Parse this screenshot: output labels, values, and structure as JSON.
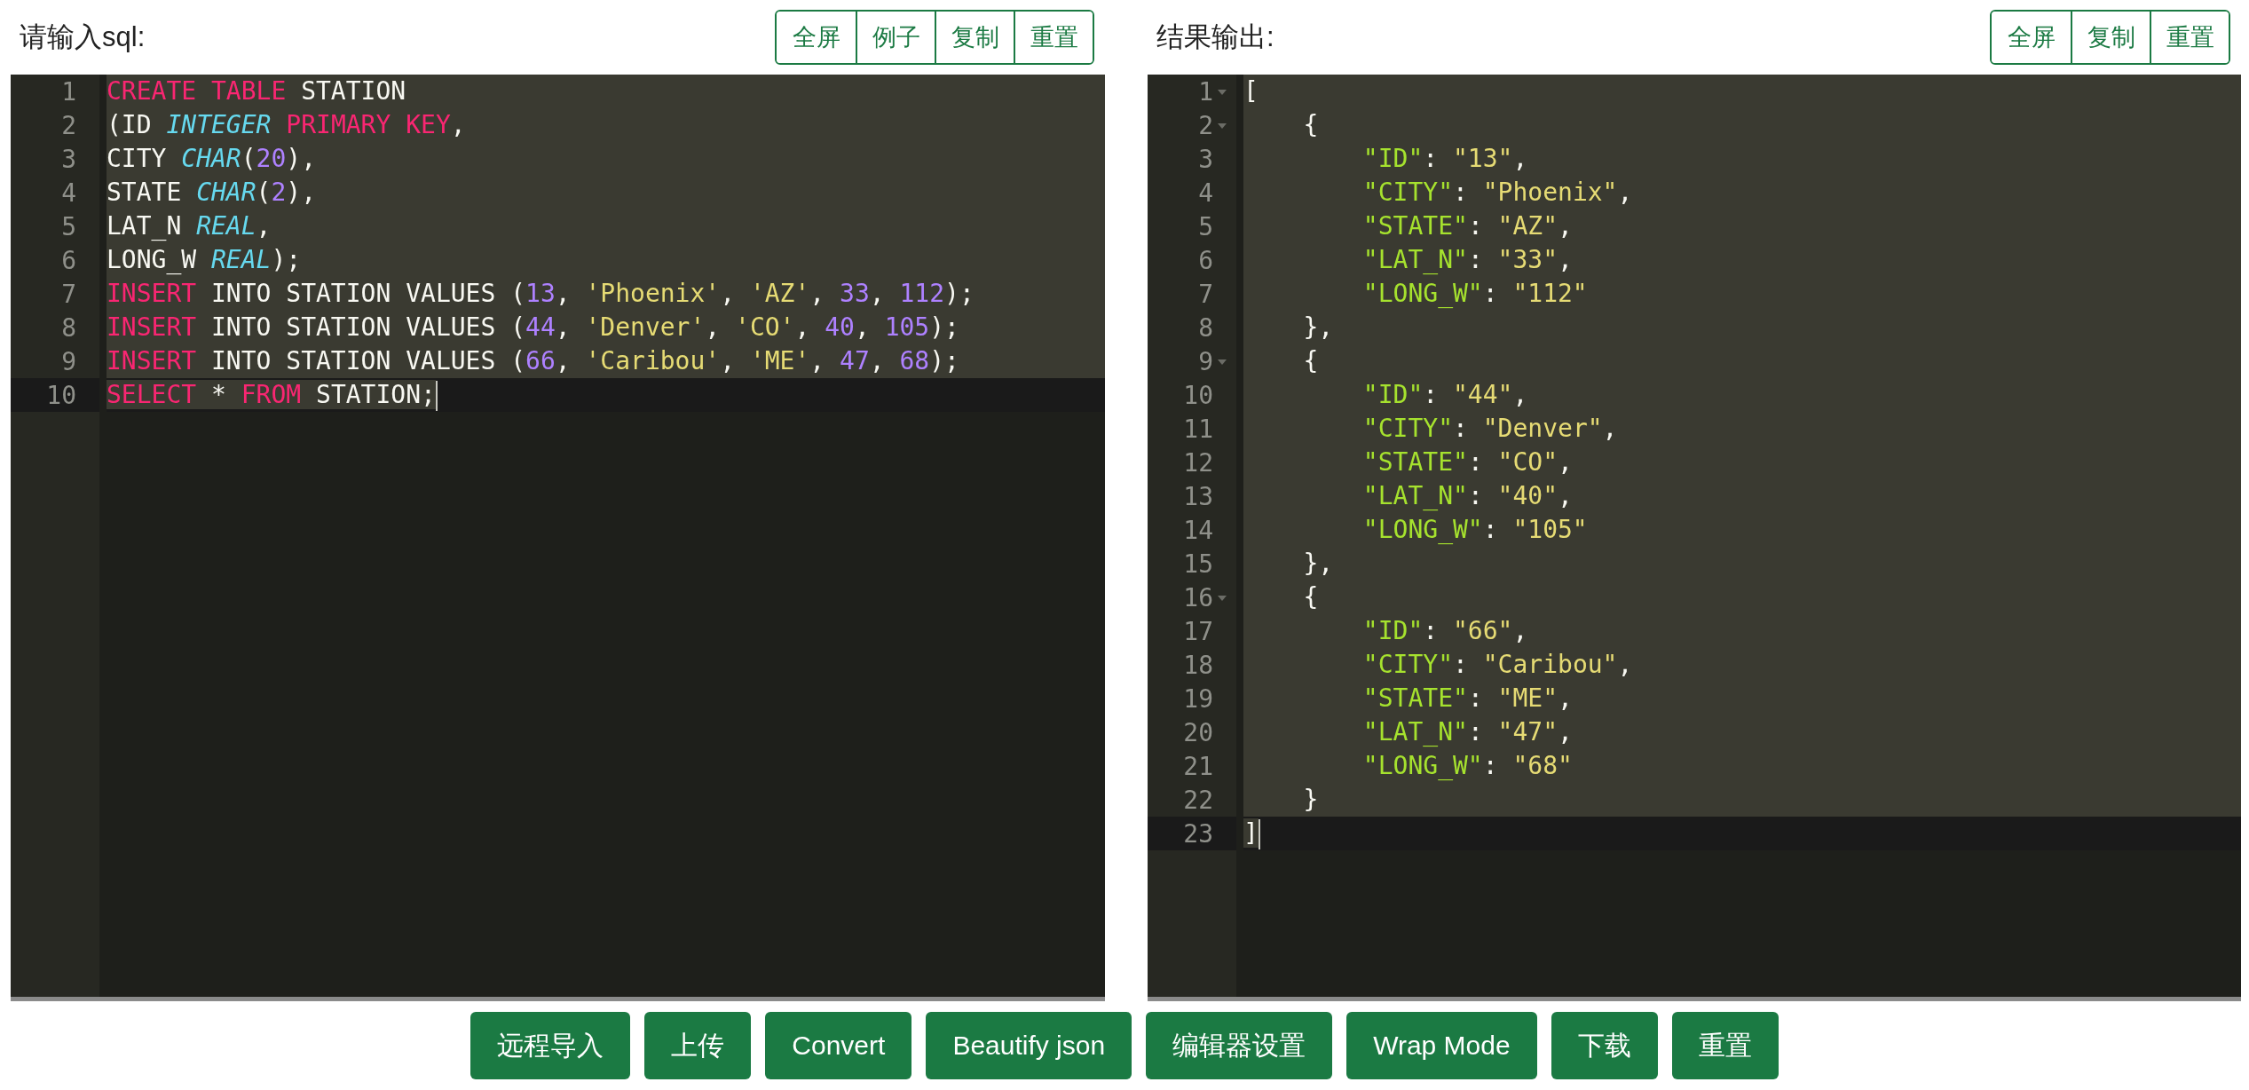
{
  "input_panel": {
    "title": "请输入sql:",
    "buttons": [
      "全屏",
      "例子",
      "复制",
      "重置"
    ],
    "editor": {
      "lines": [
        {
          "number": "1",
          "active": false,
          "tokens": [
            {
              "kind": "keyword",
              "text": "CREATE TABLE"
            },
            {
              "kind": "plain",
              "text": " STATION"
            }
          ]
        },
        {
          "number": "2",
          "active": false,
          "tokens": [
            {
              "kind": "plain",
              "text": "(ID "
            },
            {
              "kind": "type",
              "text": "INTEGER"
            },
            {
              "kind": "keyword",
              "text": " PRIMARY KEY"
            },
            {
              "kind": "plain",
              "text": ","
            }
          ]
        },
        {
          "number": "3",
          "active": false,
          "tokens": [
            {
              "kind": "plain",
              "text": "CITY "
            },
            {
              "kind": "type",
              "text": "CHAR"
            },
            {
              "kind": "plain",
              "text": "("
            },
            {
              "kind": "number",
              "text": "20"
            },
            {
              "kind": "plain",
              "text": "),"
            }
          ]
        },
        {
          "number": "4",
          "active": false,
          "tokens": [
            {
              "kind": "plain",
              "text": "STATE "
            },
            {
              "kind": "type",
              "text": "CHAR"
            },
            {
              "kind": "plain",
              "text": "("
            },
            {
              "kind": "number",
              "text": "2"
            },
            {
              "kind": "plain",
              "text": "),"
            }
          ]
        },
        {
          "number": "5",
          "active": false,
          "tokens": [
            {
              "kind": "plain",
              "text": "LAT_N "
            },
            {
              "kind": "type",
              "text": "REAL"
            },
            {
              "kind": "plain",
              "text": ","
            }
          ]
        },
        {
          "number": "6",
          "active": false,
          "tokens": [
            {
              "kind": "plain",
              "text": "LONG_W "
            },
            {
              "kind": "type",
              "text": "REAL"
            },
            {
              "kind": "plain",
              "text": ");"
            }
          ]
        },
        {
          "number": "7",
          "active": false,
          "tokens": [
            {
              "kind": "keyword",
              "text": "INSERT"
            },
            {
              "kind": "plain",
              "text": " INTO STATION VALUES ("
            },
            {
              "kind": "number",
              "text": "13"
            },
            {
              "kind": "plain",
              "text": ", "
            },
            {
              "kind": "string",
              "text": "'Phoenix'"
            },
            {
              "kind": "plain",
              "text": ", "
            },
            {
              "kind": "string",
              "text": "'AZ'"
            },
            {
              "kind": "plain",
              "text": ", "
            },
            {
              "kind": "number",
              "text": "33"
            },
            {
              "kind": "plain",
              "text": ", "
            },
            {
              "kind": "number",
              "text": "112"
            },
            {
              "kind": "plain",
              "text": ");"
            }
          ]
        },
        {
          "number": "8",
          "active": false,
          "tokens": [
            {
              "kind": "keyword",
              "text": "INSERT"
            },
            {
              "kind": "plain",
              "text": " INTO STATION VALUES ("
            },
            {
              "kind": "number",
              "text": "44"
            },
            {
              "kind": "plain",
              "text": ", "
            },
            {
              "kind": "string",
              "text": "'Denver'"
            },
            {
              "kind": "plain",
              "text": ", "
            },
            {
              "kind": "string",
              "text": "'CO'"
            },
            {
              "kind": "plain",
              "text": ", "
            },
            {
              "kind": "number",
              "text": "40"
            },
            {
              "kind": "plain",
              "text": ", "
            },
            {
              "kind": "number",
              "text": "105"
            },
            {
              "kind": "plain",
              "text": ");"
            }
          ]
        },
        {
          "number": "9",
          "active": false,
          "tokens": [
            {
              "kind": "keyword",
              "text": "INSERT"
            },
            {
              "kind": "plain",
              "text": " INTO STATION VALUES ("
            },
            {
              "kind": "number",
              "text": "66"
            },
            {
              "kind": "plain",
              "text": ", "
            },
            {
              "kind": "string",
              "text": "'Caribou'"
            },
            {
              "kind": "plain",
              "text": ", "
            },
            {
              "kind": "string",
              "text": "'ME'"
            },
            {
              "kind": "plain",
              "text": ", "
            },
            {
              "kind": "number",
              "text": "47"
            },
            {
              "kind": "plain",
              "text": ", "
            },
            {
              "kind": "number",
              "text": "68"
            },
            {
              "kind": "plain",
              "text": ");"
            }
          ]
        },
        {
          "number": "10",
          "active": true,
          "tokens": [
            {
              "kind": "keyword",
              "text": "SELECT"
            },
            {
              "kind": "plain",
              "text": " * "
            },
            {
              "kind": "keyword",
              "text": "FROM"
            },
            {
              "kind": "plain",
              "text": " STATION;"
            }
          ]
        }
      ]
    }
  },
  "output_panel": {
    "title": "结果输出:",
    "buttons": [
      "全屏",
      "复制",
      "重置"
    ],
    "editor": {
      "lines": [
        {
          "number": "1",
          "active": false,
          "foldable": true,
          "tokens": [
            {
              "kind": "plain",
              "text": "["
            }
          ]
        },
        {
          "number": "2",
          "active": false,
          "foldable": true,
          "tokens": [
            {
              "kind": "plain",
              "text": "    {"
            }
          ]
        },
        {
          "number": "3",
          "active": false,
          "foldable": false,
          "tokens": [
            {
              "kind": "key",
              "text": "        \"ID\""
            },
            {
              "kind": "plain",
              "text": ": "
            },
            {
              "kind": "string",
              "text": "\"13\""
            },
            {
              "kind": "plain",
              "text": ","
            }
          ]
        },
        {
          "number": "4",
          "active": false,
          "foldable": false,
          "tokens": [
            {
              "kind": "key",
              "text": "        \"CITY\""
            },
            {
              "kind": "plain",
              "text": ": "
            },
            {
              "kind": "string",
              "text": "\"Phoenix\""
            },
            {
              "kind": "plain",
              "text": ","
            }
          ]
        },
        {
          "number": "5",
          "active": false,
          "foldable": false,
          "tokens": [
            {
              "kind": "key",
              "text": "        \"STATE\""
            },
            {
              "kind": "plain",
              "text": ": "
            },
            {
              "kind": "string",
              "text": "\"AZ\""
            },
            {
              "kind": "plain",
              "text": ","
            }
          ]
        },
        {
          "number": "6",
          "active": false,
          "foldable": false,
          "tokens": [
            {
              "kind": "key",
              "text": "        \"LAT_N\""
            },
            {
              "kind": "plain",
              "text": ": "
            },
            {
              "kind": "string",
              "text": "\"33\""
            },
            {
              "kind": "plain",
              "text": ","
            }
          ]
        },
        {
          "number": "7",
          "active": false,
          "foldable": false,
          "tokens": [
            {
              "kind": "key",
              "text": "        \"LONG_W\""
            },
            {
              "kind": "plain",
              "text": ": "
            },
            {
              "kind": "string",
              "text": "\"112\""
            }
          ]
        },
        {
          "number": "8",
          "active": false,
          "foldable": false,
          "tokens": [
            {
              "kind": "plain",
              "text": "    },"
            }
          ]
        },
        {
          "number": "9",
          "active": false,
          "foldable": true,
          "tokens": [
            {
              "kind": "plain",
              "text": "    {"
            }
          ]
        },
        {
          "number": "10",
          "active": false,
          "foldable": false,
          "tokens": [
            {
              "kind": "key",
              "text": "        \"ID\""
            },
            {
              "kind": "plain",
              "text": ": "
            },
            {
              "kind": "string",
              "text": "\"44\""
            },
            {
              "kind": "plain",
              "text": ","
            }
          ]
        },
        {
          "number": "11",
          "active": false,
          "foldable": false,
          "tokens": [
            {
              "kind": "key",
              "text": "        \"CITY\""
            },
            {
              "kind": "plain",
              "text": ": "
            },
            {
              "kind": "string",
              "text": "\"Denver\""
            },
            {
              "kind": "plain",
              "text": ","
            }
          ]
        },
        {
          "number": "12",
          "active": false,
          "foldable": false,
          "tokens": [
            {
              "kind": "key",
              "text": "        \"STATE\""
            },
            {
              "kind": "plain",
              "text": ": "
            },
            {
              "kind": "string",
              "text": "\"CO\""
            },
            {
              "kind": "plain",
              "text": ","
            }
          ]
        },
        {
          "number": "13",
          "active": false,
          "foldable": false,
          "tokens": [
            {
              "kind": "key",
              "text": "        \"LAT_N\""
            },
            {
              "kind": "plain",
              "text": ": "
            },
            {
              "kind": "string",
              "text": "\"40\""
            },
            {
              "kind": "plain",
              "text": ","
            }
          ]
        },
        {
          "number": "14",
          "active": false,
          "foldable": false,
          "tokens": [
            {
              "kind": "key",
              "text": "        \"LONG_W\""
            },
            {
              "kind": "plain",
              "text": ": "
            },
            {
              "kind": "string",
              "text": "\"105\""
            }
          ]
        },
        {
          "number": "15",
          "active": false,
          "foldable": false,
          "tokens": [
            {
              "kind": "plain",
              "text": "    },"
            }
          ]
        },
        {
          "number": "16",
          "active": false,
          "foldable": true,
          "tokens": [
            {
              "kind": "plain",
              "text": "    {"
            }
          ]
        },
        {
          "number": "17",
          "active": false,
          "foldable": false,
          "tokens": [
            {
              "kind": "key",
              "text": "        \"ID\""
            },
            {
              "kind": "plain",
              "text": ": "
            },
            {
              "kind": "string",
              "text": "\"66\""
            },
            {
              "kind": "plain",
              "text": ","
            }
          ]
        },
        {
          "number": "18",
          "active": false,
          "foldable": false,
          "tokens": [
            {
              "kind": "key",
              "text": "        \"CITY\""
            },
            {
              "kind": "plain",
              "text": ": "
            },
            {
              "kind": "string",
              "text": "\"Caribou\""
            },
            {
              "kind": "plain",
              "text": ","
            }
          ]
        },
        {
          "number": "19",
          "active": false,
          "foldable": false,
          "tokens": [
            {
              "kind": "key",
              "text": "        \"STATE\""
            },
            {
              "kind": "plain",
              "text": ": "
            },
            {
              "kind": "string",
              "text": "\"ME\""
            },
            {
              "kind": "plain",
              "text": ","
            }
          ]
        },
        {
          "number": "20",
          "active": false,
          "foldable": false,
          "tokens": [
            {
              "kind": "key",
              "text": "        \"LAT_N\""
            },
            {
              "kind": "plain",
              "text": ": "
            },
            {
              "kind": "string",
              "text": "\"47\""
            },
            {
              "kind": "plain",
              "text": ","
            }
          ]
        },
        {
          "number": "21",
          "active": false,
          "foldable": false,
          "tokens": [
            {
              "kind": "key",
              "text": "        \"LONG_W\""
            },
            {
              "kind": "plain",
              "text": ": "
            },
            {
              "kind": "string",
              "text": "\"68\""
            }
          ]
        },
        {
          "number": "22",
          "active": false,
          "foldable": false,
          "tokens": [
            {
              "kind": "plain",
              "text": "    }"
            }
          ]
        },
        {
          "number": "23",
          "active": true,
          "foldable": false,
          "tokens": [
            {
              "kind": "plain",
              "text": "]"
            }
          ]
        }
      ]
    }
  },
  "toolbar": {
    "buttons": [
      "远程导入",
      "上传",
      "Convert",
      "Beautify json",
      "编辑器设置",
      "Wrap Mode",
      "下载",
      "重置"
    ]
  }
}
